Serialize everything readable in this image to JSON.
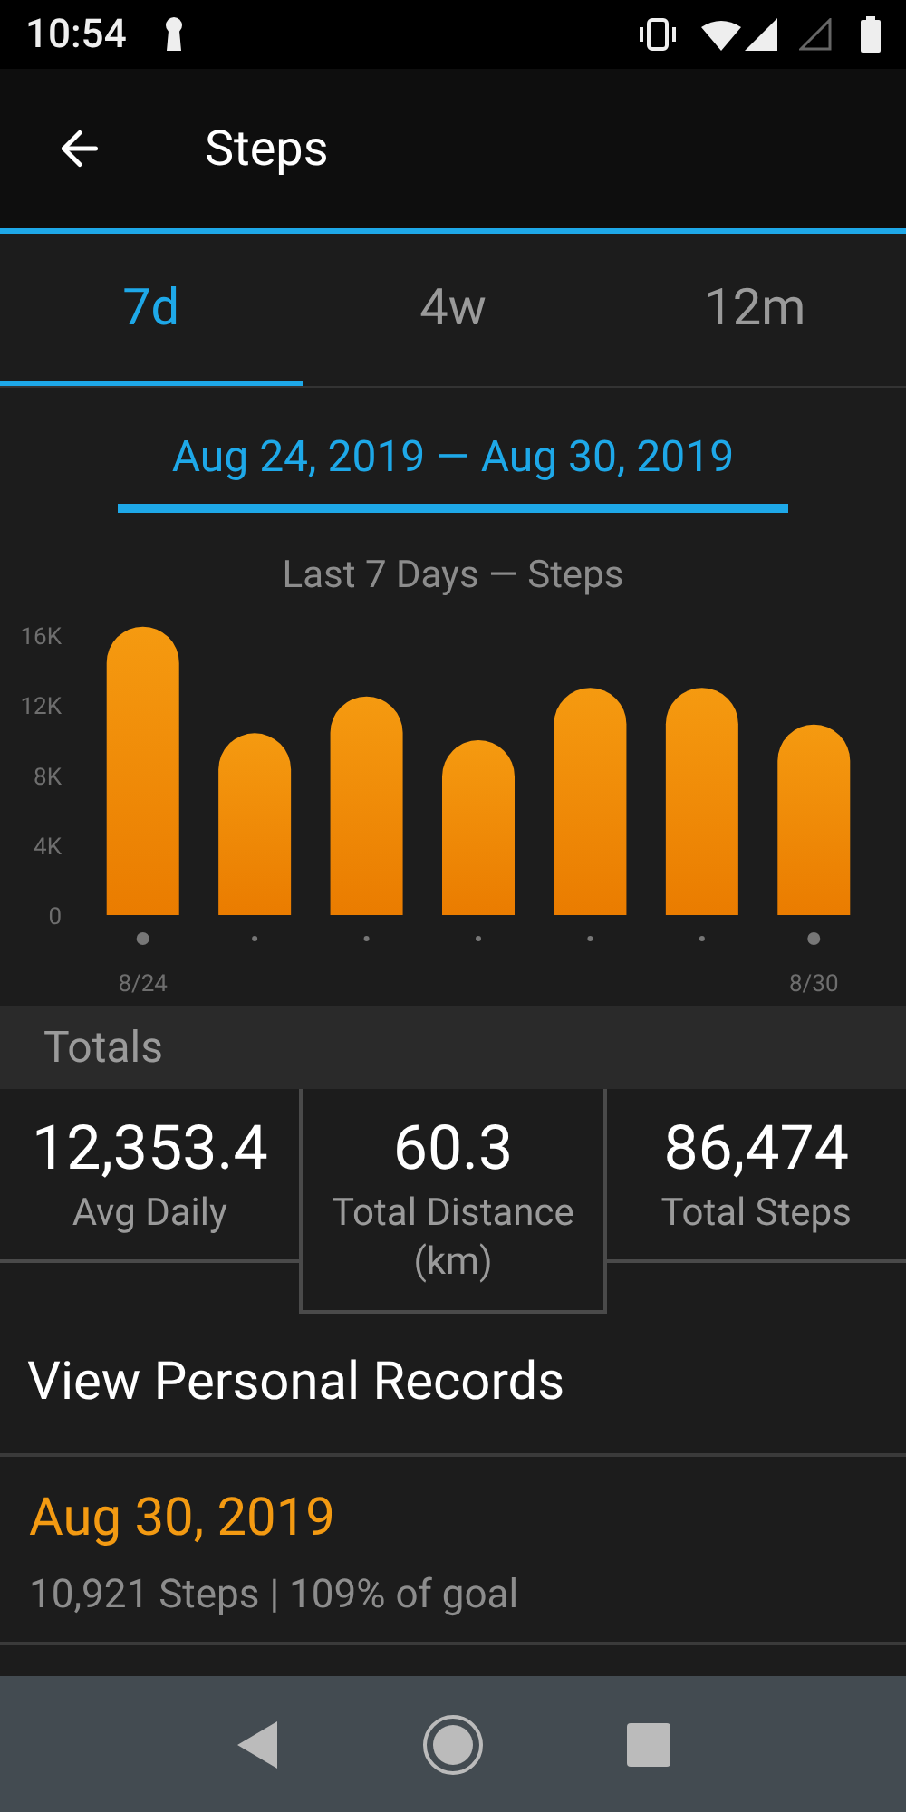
{
  "status_bar": {
    "time": "10:54"
  },
  "app_bar": {
    "title": "Steps"
  },
  "tabs": [
    {
      "label": "7d",
      "selected": true
    },
    {
      "label": "4w",
      "selected": false
    },
    {
      "label": "12m",
      "selected": false
    }
  ],
  "date_range": "Aug 24, 2019 — Aug 30, 2019",
  "chart": {
    "chart_data": {
      "type": "bar",
      "title": "Last 7 Days — Steps",
      "categories": [
        "8/24",
        null,
        null,
        null,
        null,
        null,
        "8/30"
      ],
      "series": [
        {
          "color": "#f59a10",
          "values": [
            16500,
            10400,
            12500,
            10000,
            13000,
            13000,
            10900
          ]
        }
      ],
      "ylim": [
        0,
        17000
      ],
      "yticks": [
        {
          "value": 0,
          "label": "0"
        },
        {
          "value": 4000,
          "label": "4K"
        },
        {
          "value": 8000,
          "label": "8K"
        },
        {
          "value": 12000,
          "label": "12K"
        },
        {
          "value": 16000,
          "label": "16K"
        }
      ]
    }
  },
  "totals": {
    "header": "Totals",
    "stats": [
      {
        "value": "12,353.4",
        "label": "Avg Daily",
        "highlighted": false
      },
      {
        "value": "60.3",
        "label": "Total Distance (km)",
        "highlighted": true
      },
      {
        "value": "86,474",
        "label": "Total Steps",
        "highlighted": false
      }
    ]
  },
  "personal_records_link": "View Personal Records",
  "record": {
    "date": "Aug 30, 2019",
    "detail": "10,921 Steps | 109% of goal"
  }
}
